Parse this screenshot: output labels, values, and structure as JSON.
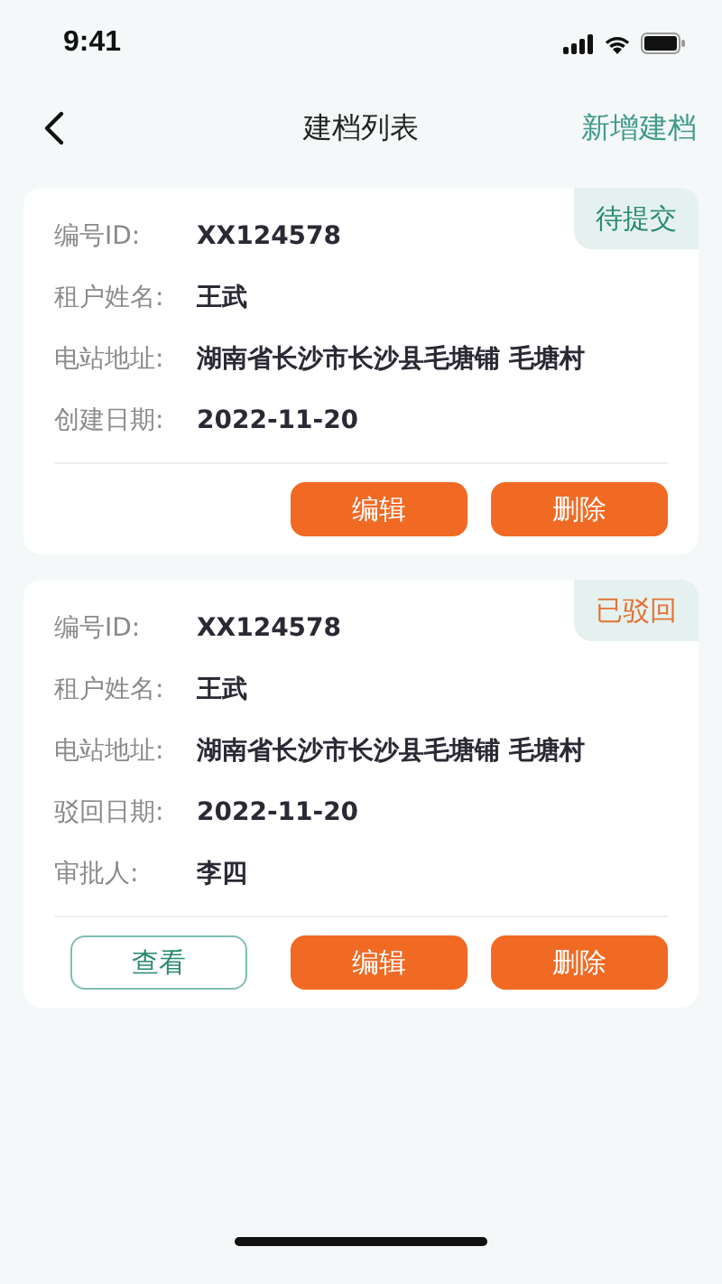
{
  "status_bar": {
    "time": "9:41"
  },
  "nav": {
    "title": "建档列表",
    "action": "新增建档"
  },
  "cards": [
    {
      "status": {
        "label": "待提交",
        "kind": "pending"
      },
      "fields": [
        {
          "label": "编号ID:",
          "value": "XX124578"
        },
        {
          "label": "租户姓名:",
          "value": "王武"
        },
        {
          "label": "电站地址:",
          "value": "湖南省长沙市长沙县毛塘铺 毛塘村"
        },
        {
          "label": "创建日期:",
          "value": "2022-11-20"
        }
      ],
      "buttons": [
        {
          "label": "编辑",
          "kind": "primary"
        },
        {
          "label": "删除",
          "kind": "primary"
        }
      ]
    },
    {
      "status": {
        "label": "已驳回",
        "kind": "rejected"
      },
      "fields": [
        {
          "label": "编号ID:",
          "value": "XX124578"
        },
        {
          "label": "租户姓名:",
          "value": "王武"
        },
        {
          "label": "电站地址:",
          "value": "湖南省长沙市长沙县毛塘铺 毛塘村"
        },
        {
          "label": "驳回日期:",
          "value": "2022-11-20"
        },
        {
          "label": "审批人:",
          "value": "李四"
        }
      ],
      "buttons": [
        {
          "label": "查看",
          "kind": "outline"
        },
        {
          "label": "编辑",
          "kind": "primary"
        },
        {
          "label": "删除",
          "kind": "primary"
        }
      ]
    }
  ]
}
